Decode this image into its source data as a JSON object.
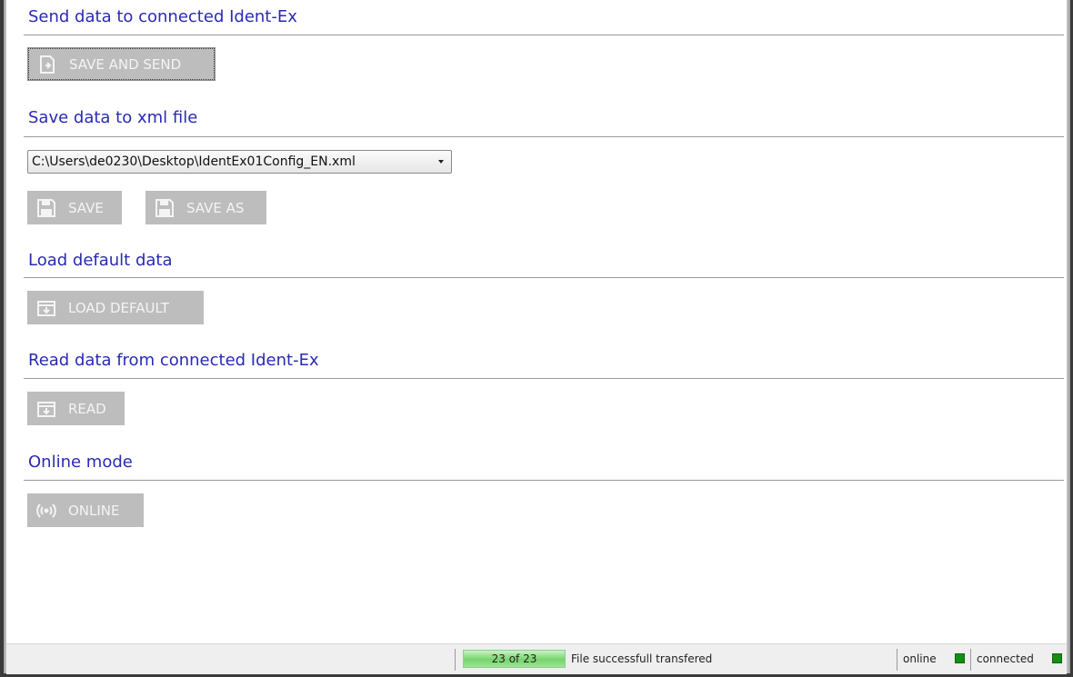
{
  "sections": {
    "send": {
      "title": "Send data to connected Ident-Ex",
      "button": "SAVE AND SEND"
    },
    "xml": {
      "title": "Save data to xml file",
      "file_path": "C:\\Users\\de0230\\Desktop\\IdentEx01Config_EN.xml",
      "save": "SAVE",
      "save_as": "SAVE AS"
    },
    "default": {
      "title": "Load default data",
      "button": "LOAD DEFAULT"
    },
    "read": {
      "title": "Read data from connected Ident-Ex",
      "button": "READ"
    },
    "online": {
      "title": "Online mode",
      "button": "ONLINE"
    }
  },
  "status": {
    "progress_text": "23 of 23",
    "progress_value": 1.0,
    "message": "File successfull transfered",
    "online_label": "online",
    "connected_label": "connected",
    "led_color": "#138f13"
  },
  "icons": {
    "send": "save-send-icon",
    "save": "floppy-disk-icon",
    "load": "load-folder-icon",
    "online": "broadcast-icon"
  }
}
